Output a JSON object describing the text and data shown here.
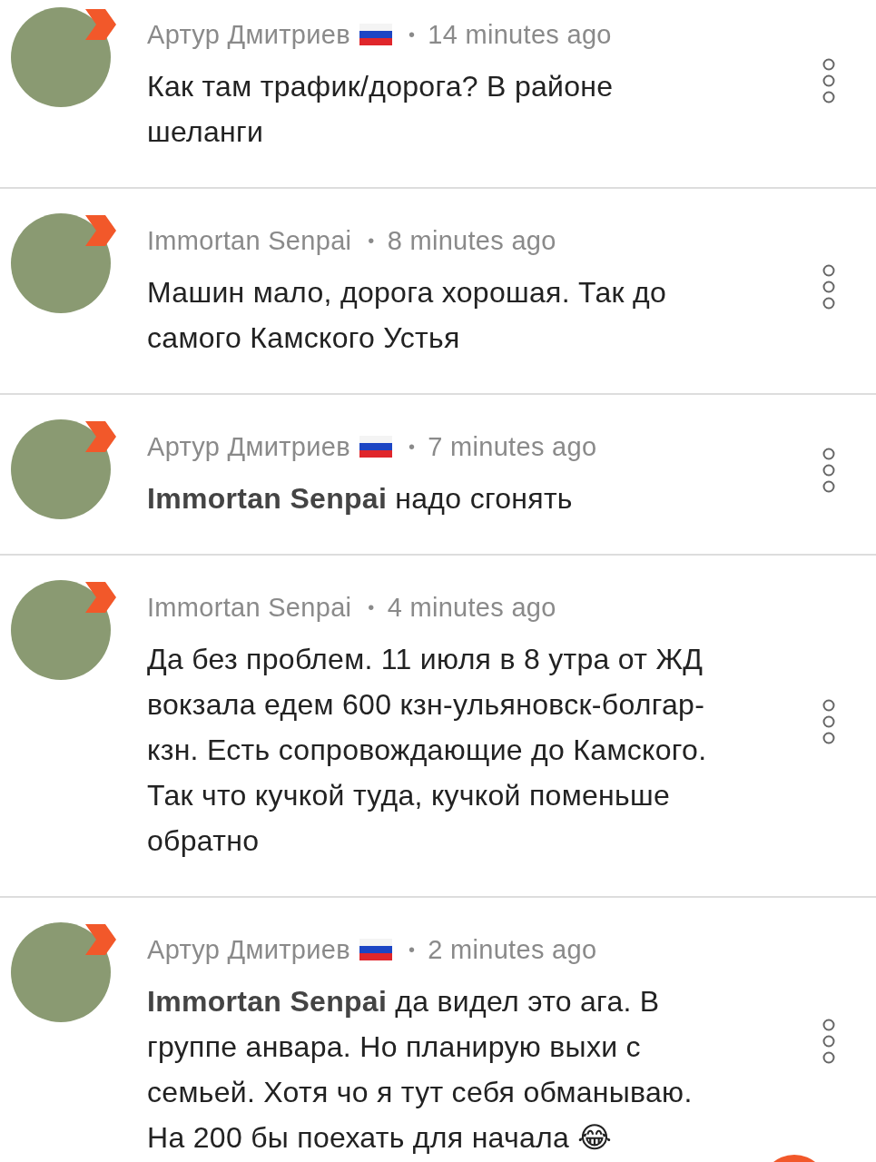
{
  "comments": [
    {
      "author": "Артур Дмитриев",
      "flag": true,
      "separator": "•",
      "time": "14 minutes ago",
      "text": "Как там трафик/дорога? В районе шеланги"
    },
    {
      "author": "Immortan Senpai",
      "flag": false,
      "separator": "•",
      "time": "8 minutes ago",
      "text": "Машин мало, дорога хорошая. Так до самого Камского Устья"
    },
    {
      "author": "Артур Дмитриев",
      "flag": true,
      "separator": "•",
      "time": "7 minutes ago",
      "text": "**Immortan Senpai** надо сгонять"
    },
    {
      "author": "Immortan Senpai",
      "flag": false,
      "separator": "•",
      "time": "4 minutes ago",
      "text": "Да без проблем. 11 июля в 8 утра от ЖД вокзала едем 600 кзн-ульяновск-болгар-кзн. Есть сопровождающие до Камского. Так что кучкой туда, кучкой поменьше обратно"
    },
    {
      "author": "Артур Дмитриев",
      "flag": true,
      "separator": "•",
      "time": "2 minutes ago",
      "text": "**Immortan Senpai** да видел это ага. В группе анвара. Но планирую выхи с семьей. Хотя чо я тут себя обманываю. На 200 бы поехать для начала 😂"
    }
  ]
}
